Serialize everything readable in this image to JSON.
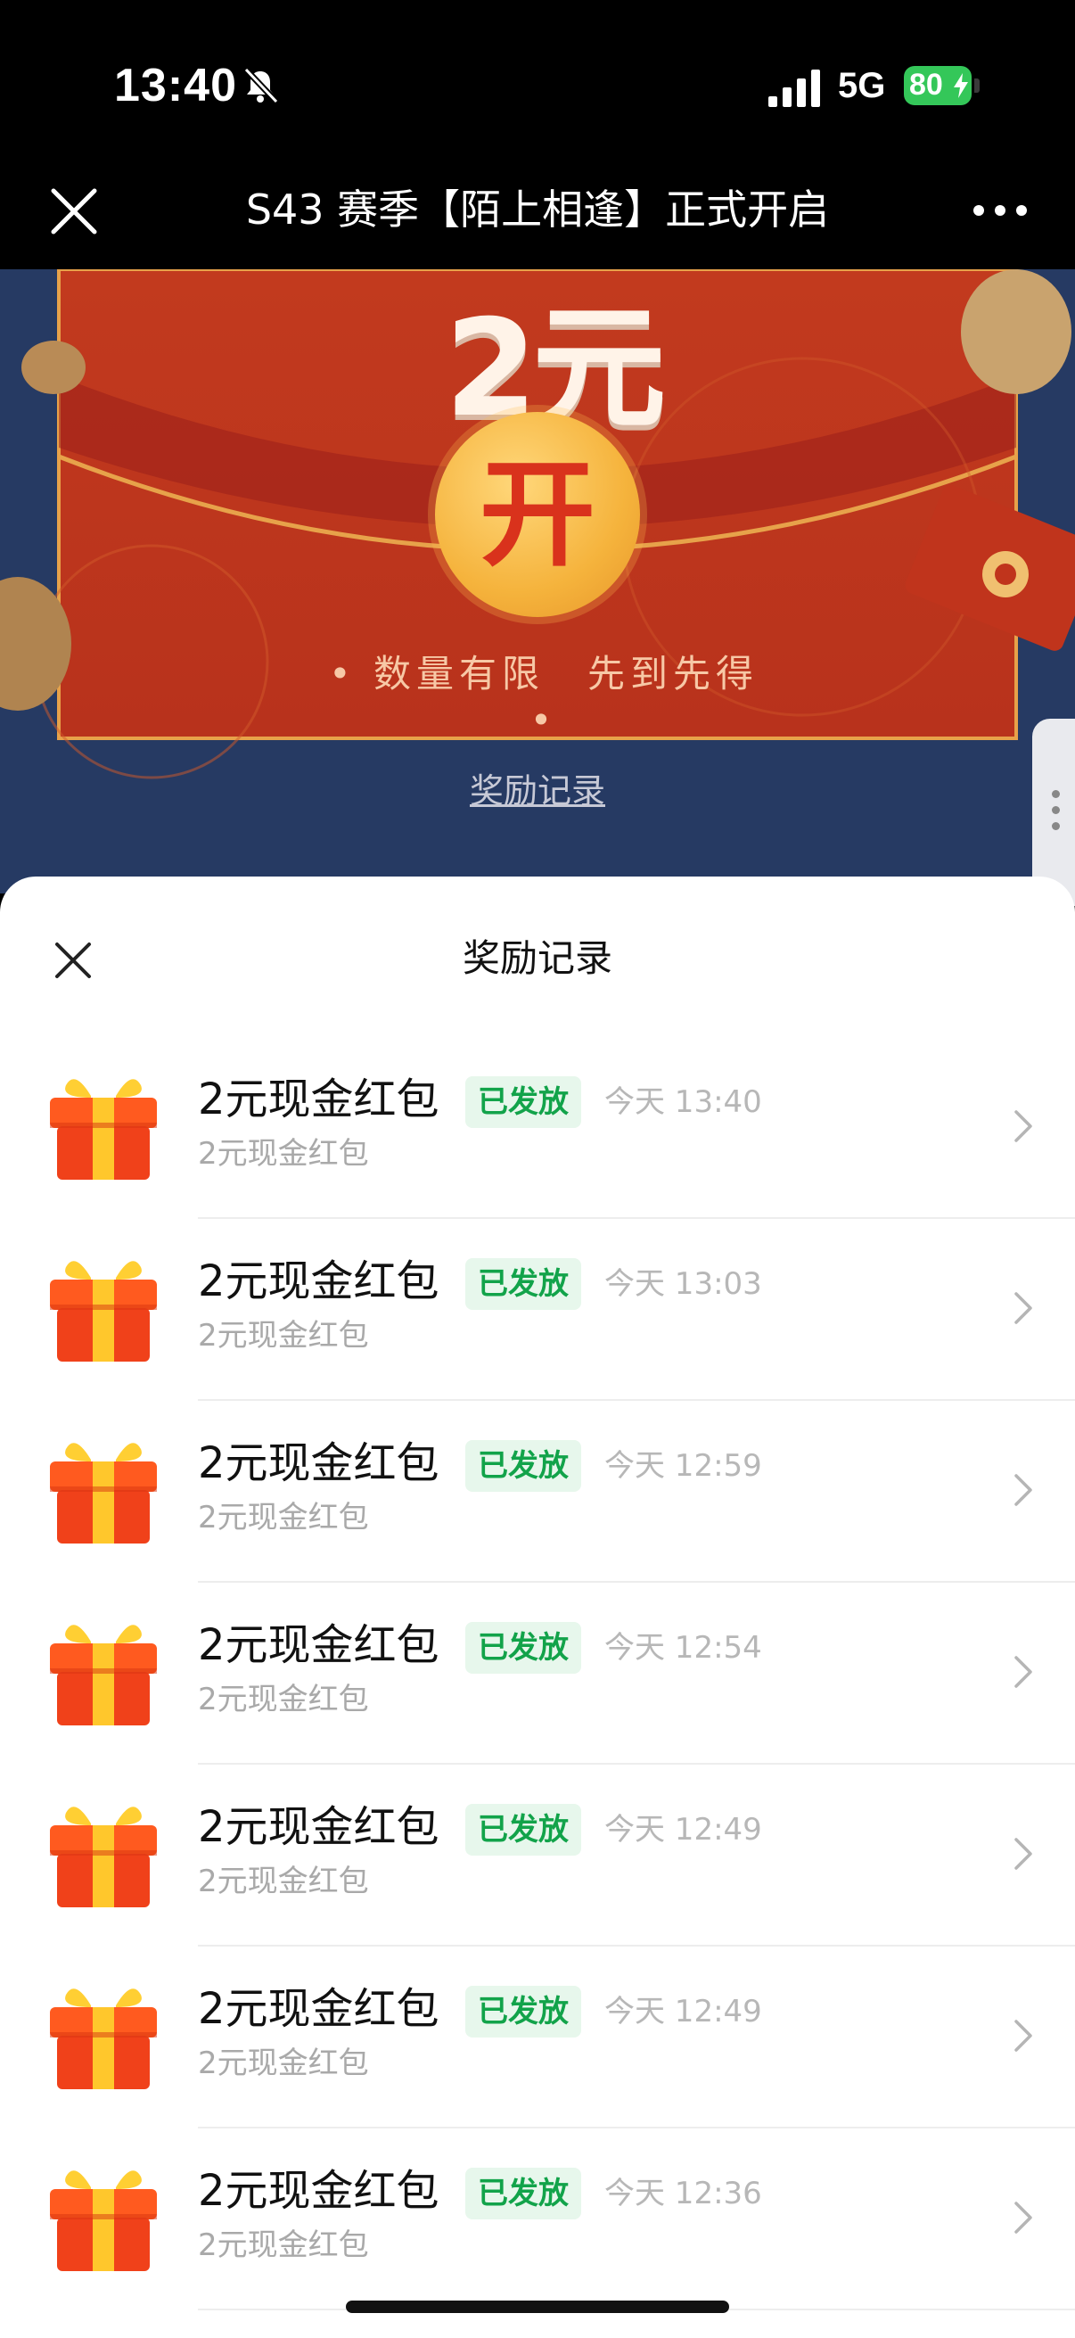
{
  "status_bar": {
    "time": "13:40",
    "network": "5G",
    "battery": "80"
  },
  "nav": {
    "title": "S43 赛季【陌上相逢】正式开启"
  },
  "banner": {
    "amount": "2元",
    "open_label": "开",
    "slogan": "• 数量有限　先到先得 •",
    "link": "奖励记录"
  },
  "sheet": {
    "title": "奖励记录",
    "records": [
      {
        "title": "2元现金红包",
        "badge": "已发放",
        "time": "今天 13:40",
        "subtitle": "2元现金红包"
      },
      {
        "title": "2元现金红包",
        "badge": "已发放",
        "time": "今天 13:03",
        "subtitle": "2元现金红包"
      },
      {
        "title": "2元现金红包",
        "badge": "已发放",
        "time": "今天 12:59",
        "subtitle": "2元现金红包"
      },
      {
        "title": "2元现金红包",
        "badge": "已发放",
        "time": "今天 12:54",
        "subtitle": "2元现金红包"
      },
      {
        "title": "2元现金红包",
        "badge": "已发放",
        "time": "今天 12:49",
        "subtitle": "2元现金红包"
      },
      {
        "title": "2元现金红包",
        "badge": "已发放",
        "time": "今天 12:49",
        "subtitle": "2元现金红包"
      },
      {
        "title": "2元现金红包",
        "badge": "已发放",
        "time": "今天 12:36",
        "subtitle": "2元现金红包"
      }
    ]
  },
  "icons": {
    "close": "close-icon",
    "more": "more-icon",
    "gift": "gift-icon",
    "chevron": "chevron-right-icon"
  },
  "colors": {
    "badge_text": "#12a34a",
    "badge_bg": "#e7f7ec",
    "battery": "#34c759"
  }
}
